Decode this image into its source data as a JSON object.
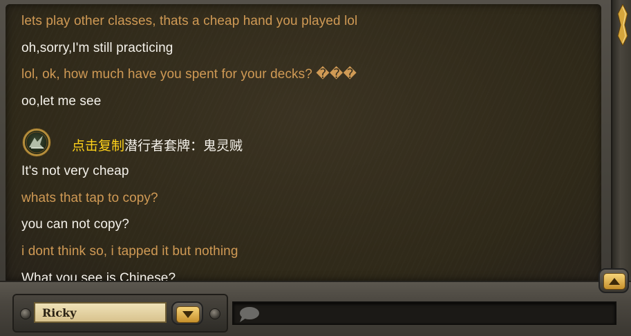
{
  "messages": [
    {
      "text": "lets play other classes, thats a cheap hand you played lol",
      "from": "other"
    },
    {
      "text": "oh,sorry,I'm still practicing",
      "from": "self"
    },
    {
      "text": "lol, ok, how much have you spent for your decks? ���",
      "from": "other"
    },
    {
      "text": "oo,let me see",
      "from": "self"
    },
    {
      "text": "It's not very cheap",
      "from": "self"
    },
    {
      "text": "whats that tap to copy?",
      "from": "other"
    },
    {
      "text": "you can not copy?",
      "from": "self"
    },
    {
      "text": "i dont think so, i tapped it but nothing",
      "from": "other"
    },
    {
      "text": "What you see is Chinese?",
      "from": "self"
    }
  ],
  "deck_share": {
    "copy_label": "点击复制",
    "deck_name": "潜行者套牌：鬼灵贼",
    "icon": "rogue-deck-icon"
  },
  "recipient": {
    "name": "Ricky"
  },
  "input": {
    "placeholder": "",
    "icon": "chat-bubble-icon"
  },
  "colors": {
    "other_message": "#d09a55",
    "self_message": "#f4f1ea",
    "copy_link": "#ffd21a",
    "gold_button": "#e6b24a"
  }
}
